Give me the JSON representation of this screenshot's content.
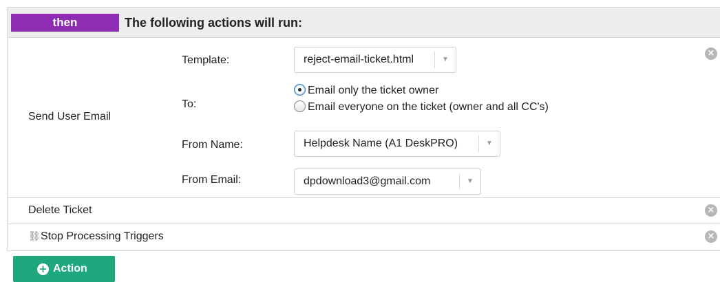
{
  "header": {
    "badge": "then",
    "title": "The following actions will run:"
  },
  "actions": {
    "send_email": {
      "label": "Send User Email",
      "template_label": "Template:",
      "template_value": "reject-email-ticket.html",
      "to_label": "To:",
      "to_options": [
        {
          "label": "Email only the ticket owner",
          "checked": true
        },
        {
          "label": "Email everyone on the ticket (owner and all CC's)",
          "checked": false
        }
      ],
      "from_name_label": "From Name:",
      "from_name_value": "Helpdesk Name (A1 DeskPRO)",
      "from_email_label": "From Email:",
      "from_email_value": "dpdownload3@gmail.com"
    },
    "delete_ticket": {
      "label": "Delete Ticket"
    },
    "stop_processing": {
      "label": "Stop Processing Triggers",
      "icon": "chain-link-broken-icon"
    }
  },
  "add_button": {
    "label": "Action"
  },
  "colors": {
    "badge": "#8e2db4",
    "add_button": "#1ea67c",
    "header_bg": "#ededed"
  }
}
